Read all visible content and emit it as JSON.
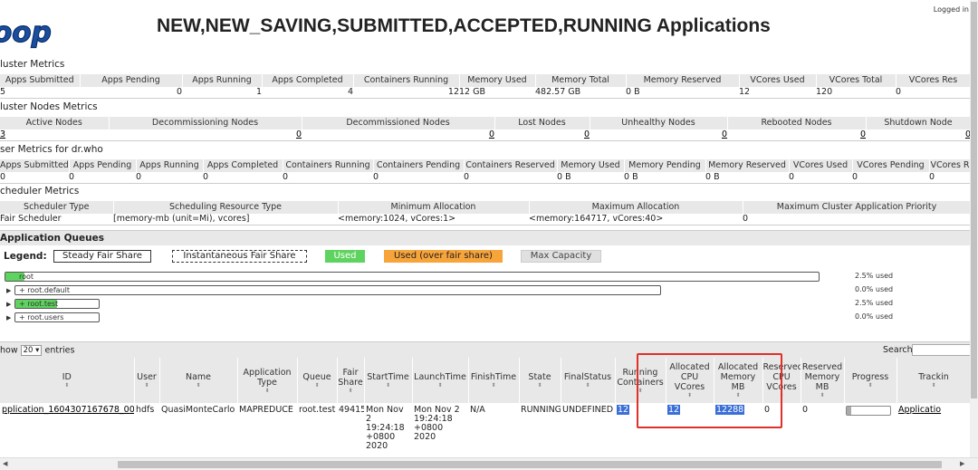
{
  "header": {
    "logo_text": "oop",
    "title": "NEW,NEW_SAVING,SUBMITTED,ACCEPTED,RUNNING Applications",
    "logged_in": "Logged in"
  },
  "cluster_metrics": {
    "title": "luster Metrics",
    "headers": [
      "Apps Submitted",
      "Apps Pending",
      "Apps Running",
      "Apps Completed",
      "Containers Running",
      "Memory Used",
      "Memory Total",
      "Memory Reserved",
      "VCores Used",
      "VCores Total",
      "VCores Res"
    ],
    "values": [
      "5",
      "0",
      "1",
      "4",
      "12",
      "12 GB",
      "482.57 GB",
      "0 B",
      "12",
      "120",
      "0"
    ]
  },
  "cluster_nodes_metrics": {
    "title": "luster Nodes Metrics",
    "headers": [
      "Active Nodes",
      "Decommissioning Nodes",
      "Decommissioned Nodes",
      "Lost Nodes",
      "Unhealthy Nodes",
      "Rebooted Nodes",
      "Shutdown Node"
    ],
    "values": [
      "3",
      "0",
      "0",
      "0",
      "0",
      "0",
      "0"
    ]
  },
  "user_metrics": {
    "title": "ser Metrics for dr.who",
    "headers": [
      "Apps Submitted",
      "Apps Pending",
      "Apps Running",
      "Apps Completed",
      "Containers Running",
      "Containers Pending",
      "Containers Reserved",
      "Memory Used",
      "Memory Pending",
      "Memory Reserved",
      "VCores Used",
      "VCores Pending",
      "VCores R"
    ],
    "values": [
      "0",
      "0",
      "0",
      "0",
      "0",
      "0",
      "0",
      "0 B",
      "0 B",
      "0 B",
      "0",
      "0",
      "0"
    ]
  },
  "scheduler_metrics": {
    "title": "cheduler Metrics",
    "headers": [
      "Scheduler Type",
      "Scheduling Resource Type",
      "Minimum Allocation",
      "Maximum Allocation",
      "Maximum Cluster Application Priority"
    ],
    "values": [
      "Fair Scheduler",
      "[memory-mb (unit=Mi), vcores]",
      "<memory:1024, vCores:1>",
      "<memory:164717, vCores:40>",
      "0"
    ]
  },
  "queues": {
    "title": "Application Queues",
    "legend_label": "Legend:",
    "legend": {
      "steady": "Steady Fair Share",
      "instantaneous": "Instantaneous Fair Share",
      "used": "Used",
      "over": "Used (over fair share)",
      "max": "Max Capacity"
    },
    "items": [
      {
        "name": "root",
        "used": "2.5% used",
        "fill": 0.025
      },
      {
        "name": "root.default",
        "used": "0.0% used",
        "fill": 0
      },
      {
        "name": "root.test",
        "used": "2.5% used",
        "fill": 0.5
      },
      {
        "name": "root.users",
        "used": "0.0% used",
        "fill": 0
      }
    ]
  },
  "apps": {
    "show_prefix": "how",
    "show_value": "20",
    "show_suffix": "entries",
    "search_label": "Search:",
    "headers": [
      "ID",
      "User",
      "Name",
      "Application Type",
      "Queue",
      "Fair Share",
      "StartTime",
      "LaunchTime",
      "FinishTime",
      "State",
      "FinalStatus",
      "Running Containers",
      "Allocated CPU VCores",
      "Allocated Memory MB",
      "Reserved CPU VCores",
      "Reserved Memory MB",
      "Progress",
      "Trackin"
    ],
    "rows": [
      {
        "id": "pplication_1604307167678_0005",
        "user": "hdfs",
        "name": "QuasiMonteCarlo",
        "type": "MAPREDUCE",
        "queue": "root.test",
        "fair_share": "49415",
        "start": "Mon Nov 2 19:24:18 +0800 2020",
        "launch": "Mon Nov 2 19:24:18 +0800 2020",
        "finish": "N/A",
        "state": "RUNNING",
        "final": "UNDEFINED",
        "running": "12",
        "cpu": "12",
        "mem": "12288",
        "rcpu": "0",
        "rmem": "0",
        "progress": 0.1,
        "tracking": "Applicatio"
      }
    ]
  },
  "colors": {
    "used": "#5fd35f",
    "over": "#f7a43b",
    "max": "#e0e0e0",
    "highlight": "#3a6fd8",
    "annotation": "#e0302a"
  }
}
